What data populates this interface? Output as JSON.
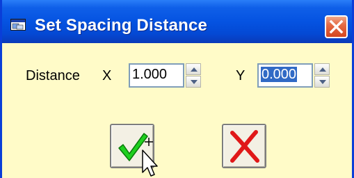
{
  "window": {
    "title": "Set Spacing Distance"
  },
  "form": {
    "distance_label": "Distance",
    "x_label": "X",
    "x_value": "1.000",
    "y_label": "Y",
    "y_value": "0.000"
  },
  "buttons": {
    "ok_icon": "checkmark-icon",
    "cancel_icon": "red-x-icon"
  },
  "colors": {
    "titlebar": "#0553e1",
    "dialog_background": "#fffbc8",
    "selection": "#316ac5",
    "check_green": "#1fd01f",
    "cancel_red": "#e01818"
  }
}
